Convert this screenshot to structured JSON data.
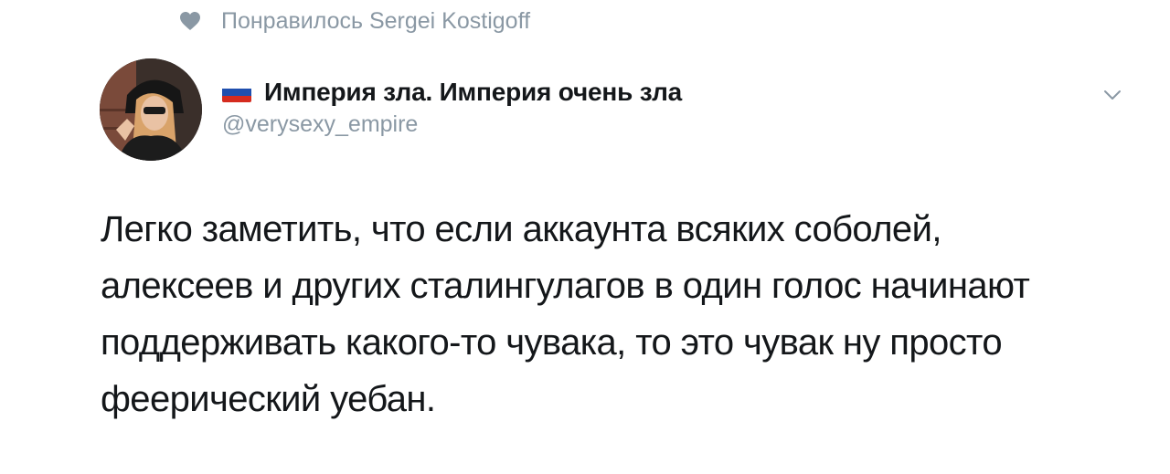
{
  "liked_bar": {
    "icon": "heart-icon",
    "text": "Понравилось Sergei Kostigoff"
  },
  "tweet": {
    "author": {
      "flag_icon": "russia-flag-icon",
      "display_name": "Империя зла. Империя очень зла",
      "handle": "@verysexy_empire"
    },
    "menu_icon": "chevron-down-icon",
    "text": "Легко заметить, что если аккаунта всяких соболей,\nалексеев и других сталингулагов  в один голос начинают\nподдерживать какого-то чувака, то это чувак ну просто\nфеерический уебан."
  },
  "colors": {
    "muted": "#8a98a4",
    "text": "#14171a",
    "flag_white": "#ffffff",
    "flag_blue": "#1f4fae",
    "flag_red": "#d52b1e"
  }
}
